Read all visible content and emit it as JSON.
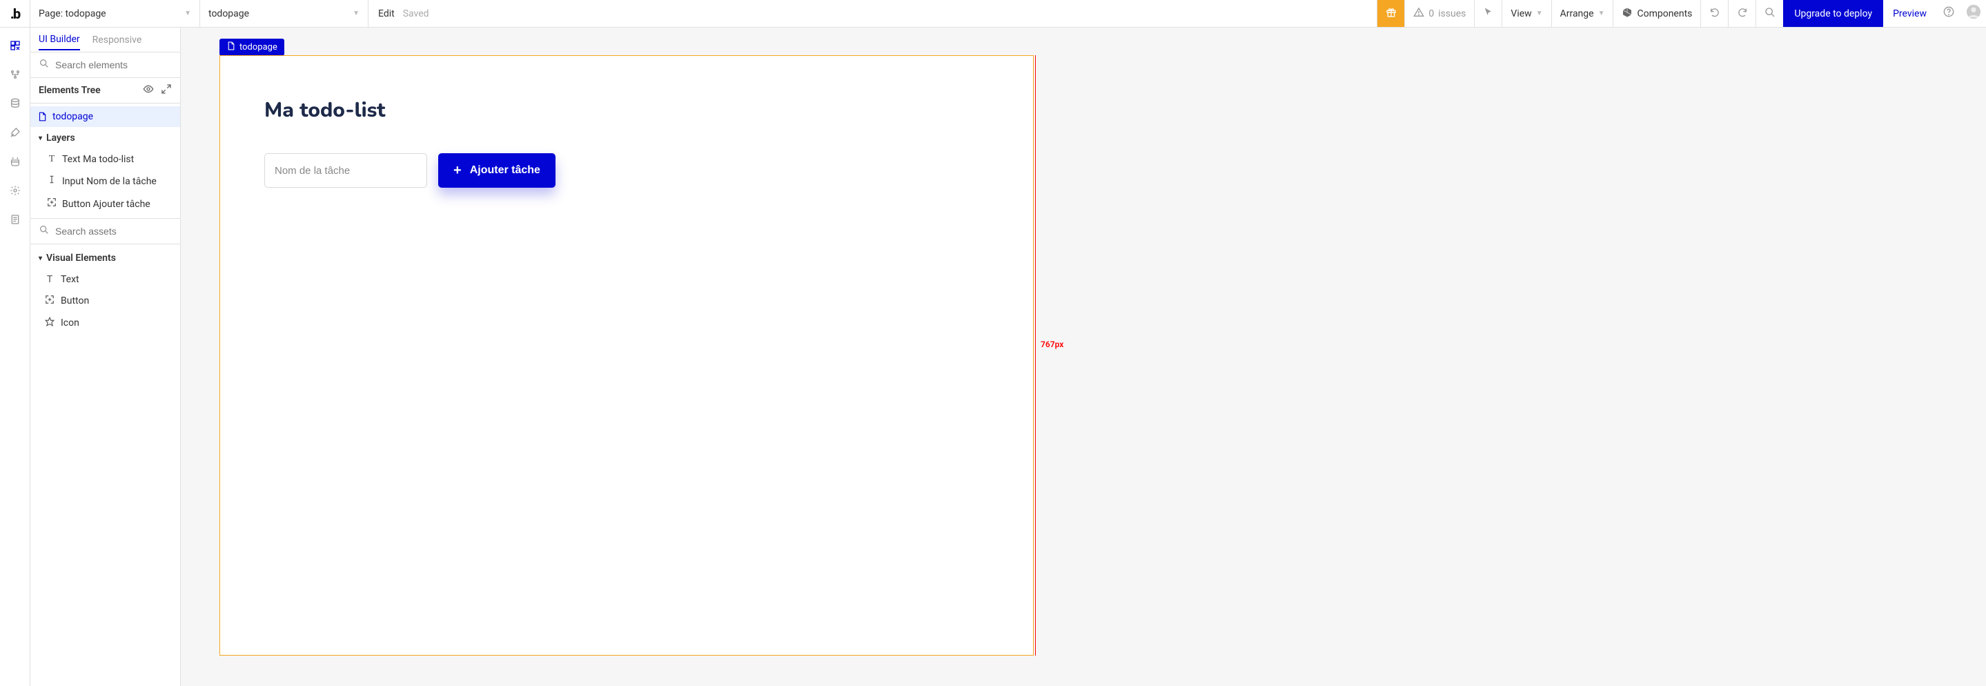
{
  "topbar": {
    "page_label_prefix": "Page: ",
    "page_name": "todopage",
    "secondary_dropdown": "todopage",
    "edit_label": "Edit",
    "save_status": "Saved",
    "issues_count": 0,
    "issues_label": "issues",
    "view_label": "View",
    "arrange_label": "Arrange",
    "components_label": "Components",
    "upgrade_label": "Upgrade to deploy",
    "preview_label": "Preview"
  },
  "sidepanel": {
    "tabs": {
      "ui_builder": "UI Builder",
      "responsive": "Responsive"
    },
    "search_elements_placeholder": "Search elements",
    "elements_tree_label": "Elements Tree",
    "tree_root": "todopage",
    "layers_label": "Layers",
    "layer_items": [
      {
        "label": "Text Ma todo-list"
      },
      {
        "label": "Input Nom de la tâche"
      },
      {
        "label": "Button Ajouter tâche"
      }
    ],
    "search_assets_placeholder": "Search assets",
    "visual_elements_label": "Visual Elements",
    "ve_items": [
      {
        "label": "Text"
      },
      {
        "label": "Button"
      },
      {
        "label": "Icon"
      }
    ]
  },
  "canvas": {
    "selection_tag": "todopage",
    "width_label": "767px",
    "page": {
      "title": "Ma todo-list",
      "task_input_placeholder": "Nom de la tâche",
      "add_button_label": "Ajouter tâche"
    }
  }
}
